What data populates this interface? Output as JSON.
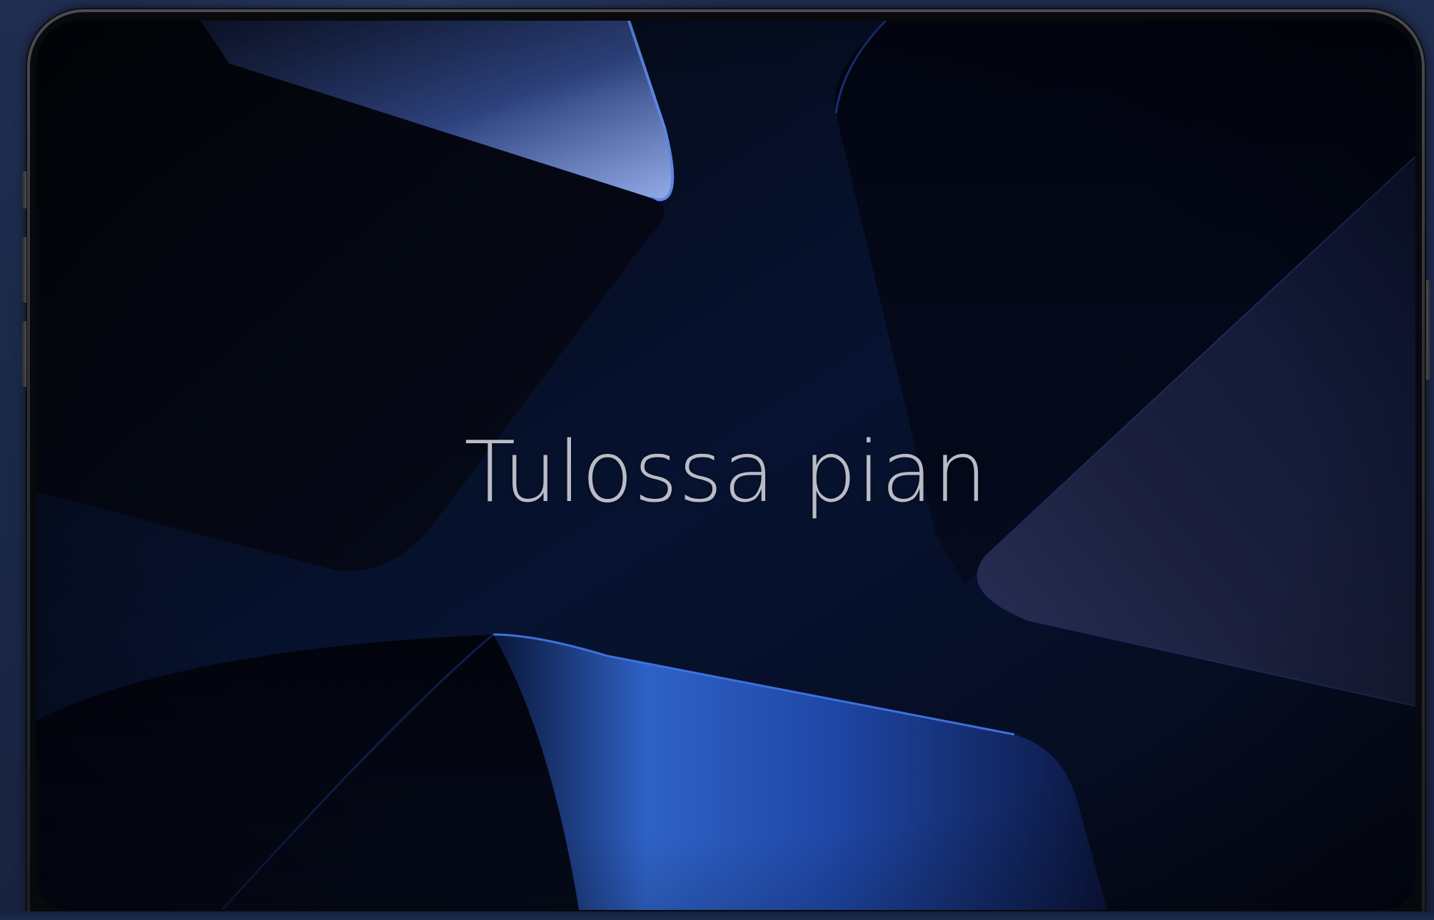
{
  "screen": {
    "headline": "Tulossa pian"
  },
  "colors": {
    "background_navy": "#1c2a4a",
    "screen_dark": "#050a1a",
    "accent_blue": "#3d6fd6",
    "highlight_blue": "#8fa8e6",
    "text_grey": "#b9bcc6",
    "device_frame": "#2d2f33"
  }
}
